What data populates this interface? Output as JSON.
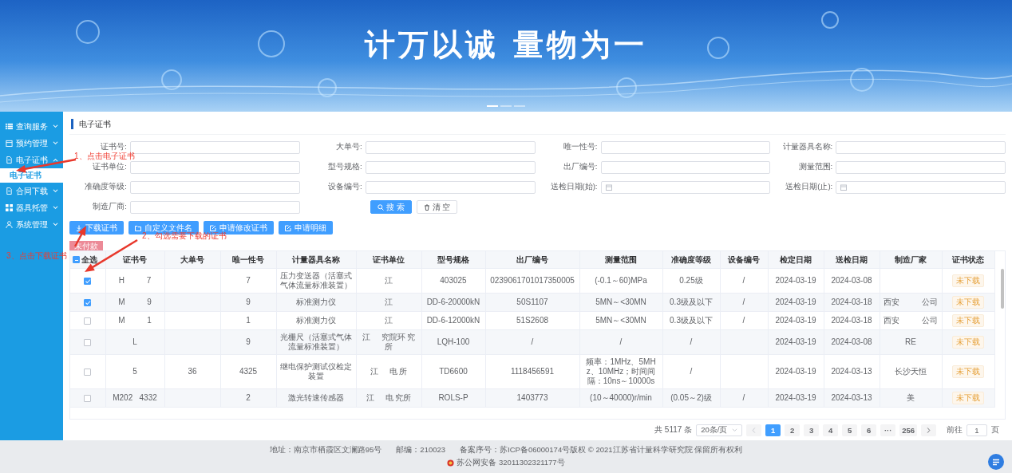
{
  "banner": {
    "slogan": [
      "计万以诚",
      "量物为一"
    ],
    "indicators": [
      {
        "selected": true
      },
      {
        "selected": false
      },
      {
        "selected": false
      }
    ]
  },
  "sidebar": {
    "items": [
      {
        "label": "查询服务",
        "expanded": false
      },
      {
        "label": "预约管理",
        "expanded": false
      },
      {
        "label": "电子证书",
        "expanded": true,
        "children": [
          {
            "label": "电子证书",
            "selected": true
          }
        ]
      },
      {
        "label": "合同下载",
        "expanded": false
      },
      {
        "label": "器具托管",
        "expanded": false
      },
      {
        "label": "系统管理",
        "expanded": false
      }
    ]
  },
  "page_title": "电子证书",
  "filters": [
    {
      "label": "证书号:",
      "kind": "text"
    },
    {
      "label": "大单号:",
      "kind": "text"
    },
    {
      "label": "唯一性号:",
      "kind": "text"
    },
    {
      "label": "计量器具名称:",
      "kind": "text"
    },
    {
      "label": "证书单位:",
      "kind": "text"
    },
    {
      "label": "型号规格:",
      "kind": "text"
    },
    {
      "label": "出厂编号:",
      "kind": "text"
    },
    {
      "label": "测量范围:",
      "kind": "text"
    },
    {
      "label": "准确度等级:",
      "kind": "text"
    },
    {
      "label": "设备编号:",
      "kind": "text"
    },
    {
      "label": "送检日期(始):",
      "kind": "date"
    },
    {
      "label": "送检日期(止):",
      "kind": "date"
    },
    {
      "label": "制造厂商:",
      "kind": "text"
    }
  ],
  "search_buttons": [
    {
      "label": "搜 索",
      "kind": "primary"
    },
    {
      "label": "清 空",
      "kind": "plain"
    }
  ],
  "actions": [
    "下载证书",
    "自定义文件名",
    "申请修改证书",
    "申请明细"
  ],
  "payment_tag": "未付款",
  "table": {
    "select_all": {
      "label": "全选",
      "indeterminate": true
    },
    "columns": [
      "证书号",
      "大单号",
      "唯一性号",
      "计量器具名称",
      "证书单位",
      "型号规格",
      "出厂编号",
      "测量范围",
      "准确度等级",
      "设备编号",
      "检定日期",
      "送检日期",
      "制造厂家",
      "证书状态"
    ],
    "rows": [
      {
        "checked": true,
        "cells": [
          "H          7",
          null,
          "7",
          "压力变送器（活塞式气体流量标准装置）",
          "江",
          "403025",
          "0239061701017350005",
          "(-0.1～60)MPa",
          "0.25级",
          "/",
          "2024-03-19",
          "2024-03-08",
          null,
          "未下载"
        ]
      },
      {
        "checked": true,
        "cells": [
          "M          9",
          null,
          "9",
          "标准测力仪",
          "江",
          "DD-6-20000kN",
          "50S1107",
          "5MN～<30MN",
          "0.3级及以下",
          "/",
          "2024-03-19",
          "2024-03-18",
          "西安          公司",
          "未下载"
        ]
      },
      {
        "checked": false,
        "cells": [
          "M          1",
          null,
          "1",
          "标准测力仪",
          "江",
          "DD-6-12000kN",
          "51S2608",
          "5MN～<30MN",
          "0.3级及以下",
          "/",
          "2024-03-19",
          "2024-03-18",
          "西安          公司",
          "未下载"
        ]
      },
      {
        "checked": false,
        "cells": [
          "L",
          null,
          "9",
          "光栅尺（活塞式气体流量标准装置）",
          "江     究院环 究所",
          "LQH-100",
          "/",
          "/",
          "/",
          null,
          "2024-03-19",
          "2024-03-08",
          "RE",
          "未下载"
        ]
      },
      {
        "checked": false,
        "cells": [
          "5",
          "36",
          "4325",
          "继电保护测试仪检定装置",
          "江     电 所",
          "TD6600",
          "1118456591",
          "频率：1MHz、5MHz、10MHz；时间间隔：10ns～10000s",
          "/",
          null,
          "2024-03-19",
          "2024-03-13",
          "长沙天恒",
          "未下载"
        ]
      },
      {
        "checked": false,
        "cells": [
          "M202   4332",
          null,
          "2",
          "激光转速传感器",
          "江     电 究所",
          "ROLS-P",
          "1403773",
          "(10～40000)r/min",
          "(0.05～2)级",
          "/",
          "2024-03-19",
          "2024-03-13",
          "美",
          "未下载"
        ]
      }
    ]
  },
  "pagination": {
    "total": "共 5117 条",
    "page_size": "20条/页",
    "pages": [
      {
        "label": "1",
        "selected": true
      },
      {
        "label": "2",
        "selected": false
      },
      {
        "label": "3",
        "selected": false
      },
      {
        "label": "4",
        "selected": false
      },
      {
        "label": "5",
        "selected": false
      },
      {
        "label": "6",
        "selected": false
      },
      {
        "label": "···",
        "selected": false
      },
      {
        "label": "256",
        "selected": false
      }
    ],
    "goto_label": "前往",
    "goto_value": "1",
    "goto_suffix": "页"
  },
  "footer": {
    "lines": [
      "地址：南京市栖霞区文澜路95号",
      "邮编：210023",
      "备案序号：苏ICP备06000174号版权 © 2021江苏省计量科学研究院 保留所有权利"
    ],
    "police_record": "苏公网安备 32011302321177号"
  },
  "annotations": [
    "1、点击电子证书",
    "2、勾选需要下载的证书",
    "3、点击下载证书"
  ]
}
